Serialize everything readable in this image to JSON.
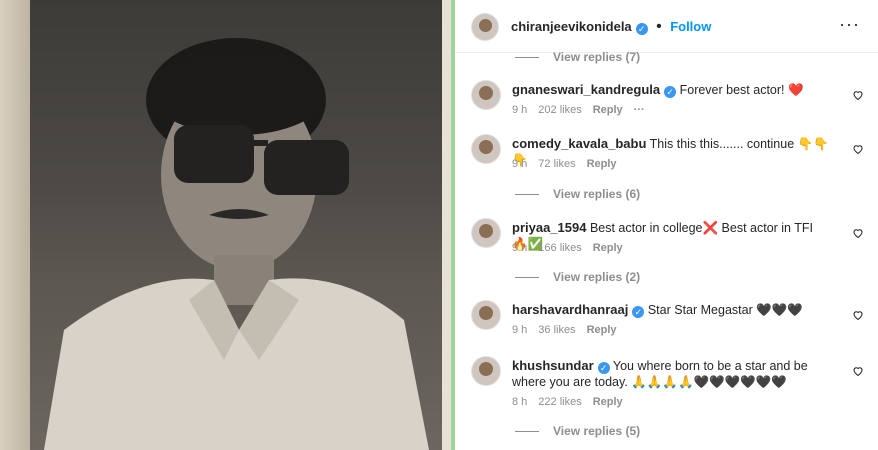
{
  "post_header": {
    "username": "chiranjeevikonidela",
    "follow_label": "Follow",
    "more_label": "···"
  },
  "reply_threads": [
    "View replies (7)",
    "View replies (6)",
    "View replies (2)",
    "View replies (5)"
  ],
  "comments": [
    {
      "username": "gnaneswari_kandregula",
      "verified": true,
      "text": "Forever best actor! ❤️",
      "time": "9 h",
      "likes": "202 likes",
      "reply": "Reply",
      "more": "···"
    },
    {
      "username": "comedy_kavala_babu",
      "verified": false,
      "text": "This this this....... continue 👇👇👇",
      "time": "9 h",
      "likes": "72 likes",
      "reply": "Reply",
      "more": ""
    },
    {
      "username": "priyaa_1594",
      "verified": false,
      "text": "Best actor in college❌ Best actor in TFI 🔥✅",
      "time": "9 h",
      "likes": "166 likes",
      "reply": "Reply",
      "more": ""
    },
    {
      "username": "harshavardhanraaj",
      "verified": true,
      "text": "Star Star Megastar 🖤🖤🖤",
      "time": "9 h",
      "likes": "36 likes",
      "reply": "Reply",
      "more": ""
    },
    {
      "username": "khushsundar",
      "verified": true,
      "text": "You where born to be a star and be where you are today. 🙏🙏🙏🙏🖤🖤🖤🖤🖤🖤",
      "time": "8 h",
      "likes": "222 likes",
      "reply": "Reply",
      "more": ""
    }
  ]
}
